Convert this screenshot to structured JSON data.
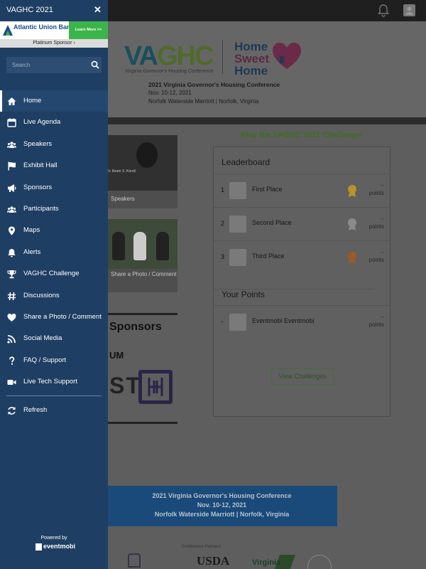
{
  "app": {
    "title": "VAGHC 2021"
  },
  "drawer": {
    "title": "VAGHC 2021",
    "ad": {
      "sponsor_name": "Atlantic Union Bank",
      "cta": "Learn More >>"
    },
    "sponsor_tier": "Platinum Sponsor ›",
    "search": {
      "placeholder": "Search",
      "value": ""
    },
    "menu": [
      {
        "label": "Home",
        "icon": "home-icon",
        "active": true
      },
      {
        "label": "Live Agenda",
        "icon": "calendar-icon"
      },
      {
        "label": "Speakers",
        "icon": "people-icon"
      },
      {
        "label": "Exhibit Hall",
        "icon": "flag-icon"
      },
      {
        "label": "Sponsors",
        "icon": "megaphone-icon"
      },
      {
        "label": "Participants",
        "icon": "people-icon"
      },
      {
        "label": "Maps",
        "icon": "map-pin-icon"
      },
      {
        "label": "Alerts",
        "icon": "bell-icon"
      },
      {
        "label": "VAGHC Challenge",
        "icon": "trophy-icon"
      },
      {
        "label": "Discussions",
        "icon": "hashtag-icon"
      },
      {
        "label": "Share a Photo / Comment",
        "icon": "heart-icon"
      },
      {
        "label": "Social Media",
        "icon": "rss-icon"
      },
      {
        "label": "FAQ / Support",
        "icon": "question-icon"
      },
      {
        "label": "Live Tech Support",
        "icon": "video-icon"
      }
    ],
    "refresh": {
      "label": "Refresh",
      "icon": "refresh-icon"
    },
    "powered_by": "Powered by",
    "brand": "eventmobi"
  },
  "banner": {
    "logo_vag": "VA",
    "logo_hc": "GHC",
    "logo_sub": "Virginia Governor's Housing Conference",
    "logo_home1": "Home",
    "logo_home2": "Sweet",
    "logo_home3": "Home",
    "conf_title": "2021 Virginia Governor's Housing Conference",
    "conf_dates": "Nov. 10-12, 2021",
    "conf_venue": "Norfolk Waterside Marriott | Norfolk, Virginia"
  },
  "tiles": [
    {
      "label": "Speakers",
      "caption": "Dr. Ibram X. Kendi"
    },
    {
      "label": "Share a Photo / Comment"
    }
  ],
  "sponsors": {
    "title": "Sponsors",
    "tier": "UM",
    "logo_text": "ST"
  },
  "challenge": {
    "title": "Play the VAGHC 2021 Challenge!",
    "leaderboard_title": "Leaderboard",
    "rows": [
      {
        "rank": "1",
        "name": "First Place",
        "points": "--",
        "unit": "points",
        "medal_color": "#b8922a"
      },
      {
        "rank": "2",
        "name": "Second Place",
        "points": "--",
        "unit": "points",
        "medal_color": "#8a8a8a"
      },
      {
        "rank": "3",
        "name": "Third Place",
        "points": "--",
        "unit": "points",
        "medal_color": "#9a5a2a"
      }
    ],
    "your_points_title": "Your Points",
    "you": {
      "rank": "-",
      "name": "Eventmobi Eventmobi",
      "points": "--",
      "unit": "points"
    },
    "view_button": "View Challenges"
  },
  "footer": {
    "line1": "2021 Virginia Governor's Housing Conference",
    "line2": "Nov. 10-12, 2021",
    "line3": "Norfolk Waterside Marriott | Norfolk, Virginia",
    "partners_label": "Conference Partners",
    "partner_usda": "USDA",
    "partner_virginia": "Virginia"
  },
  "colors": {
    "drawer_bg": "#1f3e63",
    "accent_green": "#3bb54a",
    "challenge_green": "#3f6d1f"
  }
}
